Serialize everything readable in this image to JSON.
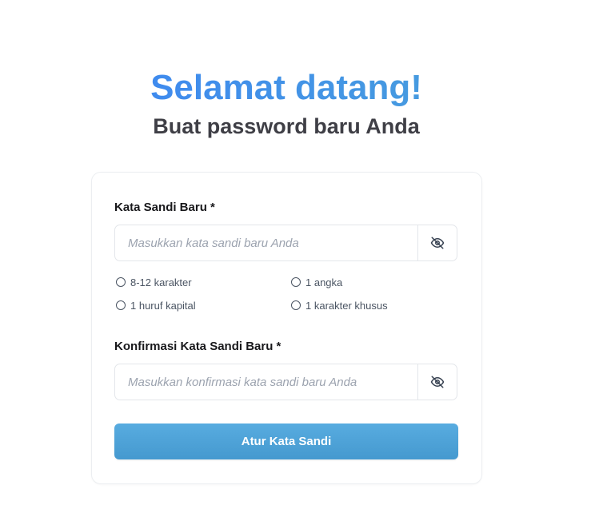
{
  "header": {
    "title": "Selamat datang!",
    "subtitle": "Buat password baru Anda"
  },
  "form": {
    "new_password": {
      "label": "Kata Sandi Baru *",
      "placeholder": "Masukkan kata sandi baru Anda",
      "value": "",
      "toggle_icon": "eye-off-icon"
    },
    "requirements": [
      {
        "label": "8-12 karakter",
        "met": false
      },
      {
        "label": "1 angka",
        "met": false
      },
      {
        "label": "1 huruf kapital",
        "met": false
      },
      {
        "label": "1 karakter khusus",
        "met": false
      }
    ],
    "confirm_password": {
      "label": "Konfirmasi Kata Sandi Baru *",
      "placeholder": "Masukkan konfirmasi kata sandi baru Anda",
      "value": "",
      "toggle_icon": "eye-off-icon"
    },
    "submit_label": "Atur Kata Sandi"
  },
  "colors": {
    "title_gradient_start": "#3b82f6",
    "title_gradient_end": "#4aa3d8",
    "button": "#4ea3d8",
    "subtitle": "#3f3f46"
  }
}
